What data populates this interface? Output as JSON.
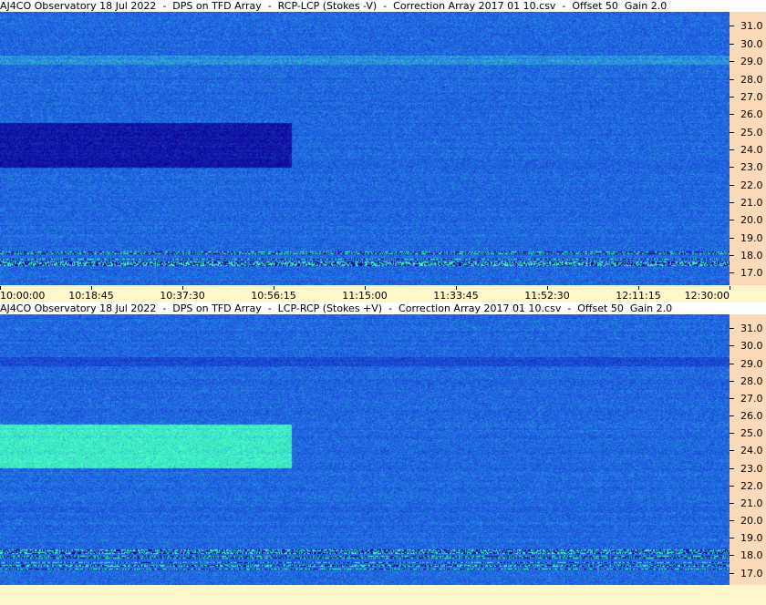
{
  "chart_data": [
    {
      "type": "heatmap",
      "title": "AJ4CO Observatory 18 Jul 2022  -  DPS on TFD Array  -  RCP-LCP (Stokes -V)  -  Correction Array 2017 01 10.csv  -  Offset 50  Gain 2.0",
      "xlabel": "",
      "ylabel": "",
      "x_ticks": [
        "10:00:00",
        "10:18:45",
        "10:37:30",
        "10:56:15",
        "11:15:00",
        "11:33:45",
        "11:52:30",
        "12:11:15",
        "12:30:00"
      ],
      "y_ticks": [
        "31.0",
        "30.0",
        "29.0",
        "28.0",
        "27.0",
        "26.0",
        "25.0",
        "24.0",
        "23.0",
        "22.0",
        "21.0",
        "20.0",
        "19.0",
        "18.0",
        "17.0"
      ],
      "xlim": [
        "10:00:00",
        "12:30:00"
      ],
      "ylim": [
        16.3,
        31.8
      ],
      "colors": {
        "background": "#1f64e6",
        "dark_band": "#10208c",
        "bright_band": "#00e6d8"
      },
      "features": [
        {
          "kind": "dark_band",
          "t_start": "10:00:00",
          "t_end": "11:00:00",
          "freq_low": 23.0,
          "freq_high": 25.5
        }
      ]
    },
    {
      "type": "heatmap",
      "title": "AJ4CO Observatory 18 Jul 2022  -  DPS on TFD Array  -  LCP-RCP (Stokes +V)  -  Correction Array 2017 01 10.csv  -  Offset 50  Gain 2.0",
      "xlabel": "",
      "ylabel": "",
      "x_ticks": [],
      "y_ticks": [
        "31.0",
        "30.0",
        "29.0",
        "28.0",
        "27.0",
        "26.0",
        "25.0",
        "24.0",
        "23.0",
        "22.0",
        "21.0",
        "20.0",
        "19.0",
        "18.0",
        "17.0"
      ],
      "xlim": [
        "10:00:00",
        "12:30:00"
      ],
      "ylim": [
        16.3,
        31.8
      ],
      "colors": {
        "background": "#1f64e6",
        "dark_band": "#10208c",
        "bright_band": "#00e6d8"
      },
      "features": [
        {
          "kind": "bright_band",
          "t_start": "10:00:00",
          "t_end": "11:00:00",
          "freq_low": 23.0,
          "freq_high": 25.5
        }
      ]
    }
  ]
}
